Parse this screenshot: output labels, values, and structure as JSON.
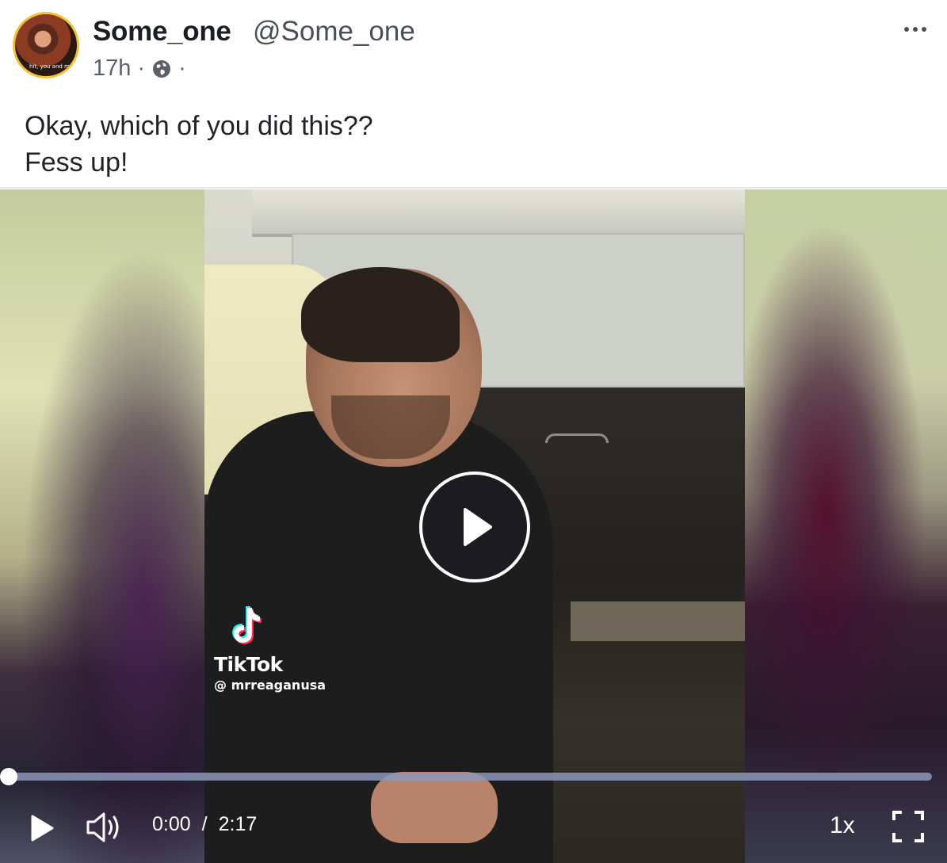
{
  "post": {
    "author_name": "Some_one",
    "author_handle": "@Some_one",
    "timestamp": "17h",
    "meta_separator": "·",
    "visibility_icon": "globe-icon",
    "more_icon": "more-horizontal-icon",
    "avatar_caption": "hit, you and m",
    "text_lines": [
      "Okay, which of you did this??",
      "Fess up!"
    ]
  },
  "video": {
    "watermark_brand": "TikTok",
    "watermark_handle": "@ mrreaganusa",
    "overlay_icon": "play-circle-icon",
    "current_time": "0:00",
    "time_separator": "/",
    "duration": "2:17",
    "progress": 0,
    "speed": "1x",
    "controls": {
      "play_icon": "play-icon",
      "volume_icon": "volume-icon",
      "fullscreen_icon": "fullscreen-icon"
    }
  },
  "colors": {
    "avatar_ring": "#f2c230",
    "text": "#1f2328",
    "secondary_text": "#5b6168",
    "progress_track": "#8c96b9"
  }
}
